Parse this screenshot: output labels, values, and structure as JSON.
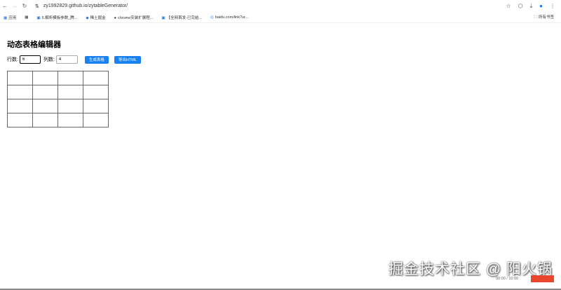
{
  "browser": {
    "url": "zy1992829.github.io/zytableGenerator/",
    "bookmarks": [
      "应用",
      "5.解析模板参数_腾...",
      "稀土掘金",
      "chrome安装扩展程...",
      "【全网首发-已完结...",
      "baidu.com/link?ur..."
    ],
    "all_bookmarks": "所有书签"
  },
  "page": {
    "title": "动态表格编辑器",
    "rows_label": "行数:",
    "rows_value": "6",
    "cols_label": "列数:",
    "cols_value": "4",
    "generate_label": "生成表格",
    "export_label": "导出HTML"
  },
  "table": {
    "rows": 4,
    "cols": 4
  },
  "overlay": {
    "watermark": "掘金技术社区 @ 阳火锅",
    "time": "00:00 / 10:00"
  }
}
